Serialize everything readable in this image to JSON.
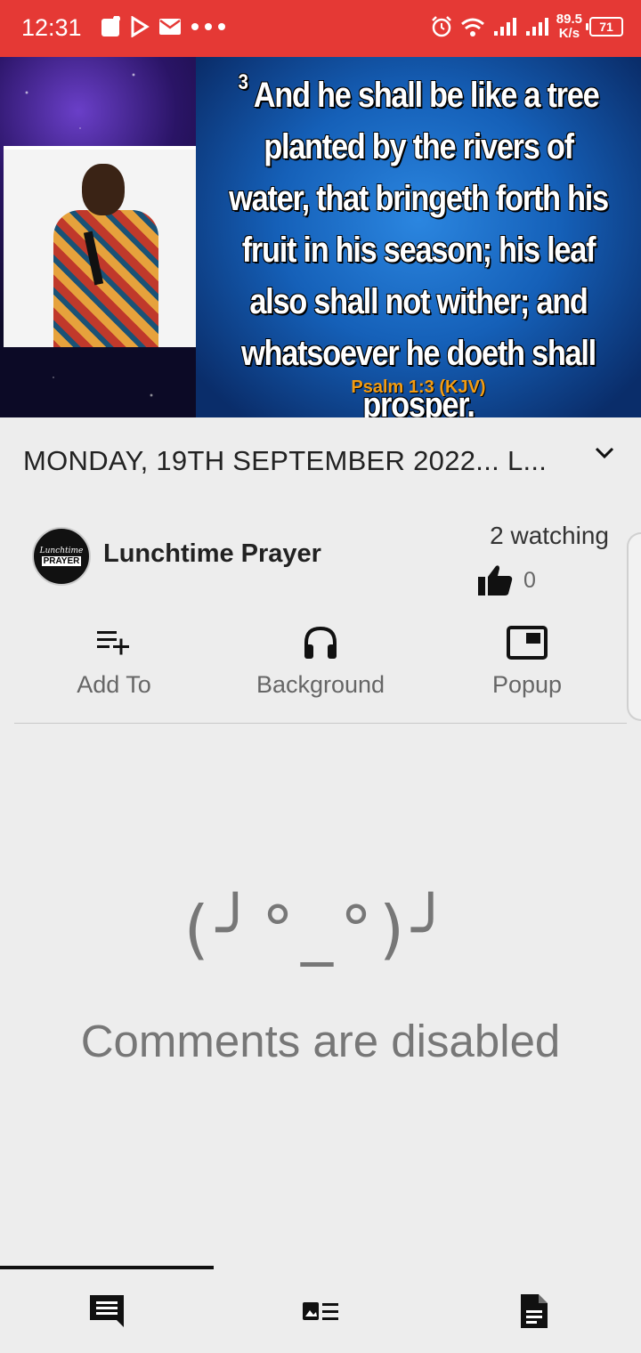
{
  "status_bar": {
    "time": "12:31",
    "speed_value": "89.5",
    "speed_unit": "K/s",
    "battery": "71"
  },
  "video": {
    "verse_number": "3",
    "verse_text": "And he shall be like a tree planted by the rivers of water, that bringeth forth his fruit in his season; his leaf also shall not wither; and whatsoever he doeth shall prosper.",
    "verse_reference": "Psalm 1:3 (KJV)"
  },
  "title": "MONDAY, 19TH SEPTEMBER 2022... L...",
  "channel": {
    "name": "Lunchtime Prayer",
    "avatar_line1": "Lunchtime",
    "avatar_line2": "PRAYER",
    "watching": "2 watching",
    "likes": "0"
  },
  "actions": [
    {
      "label": "Add To",
      "icon": "playlist-add-icon"
    },
    {
      "label": "Background",
      "icon": "headphones-icon"
    },
    {
      "label": "Popup",
      "icon": "picture-in-picture-icon"
    }
  ],
  "comments": {
    "kaomoji": "(╯°_°)╯",
    "message": "Comments are disabled"
  },
  "tabs": [
    {
      "icon": "comment-icon",
      "selected": true
    },
    {
      "icon": "related-items-icon",
      "selected": false
    },
    {
      "icon": "description-icon",
      "selected": false
    }
  ],
  "colors": {
    "status_bar": "#e53935",
    "background": "#ededed",
    "verse_reference": "#f39c12"
  }
}
